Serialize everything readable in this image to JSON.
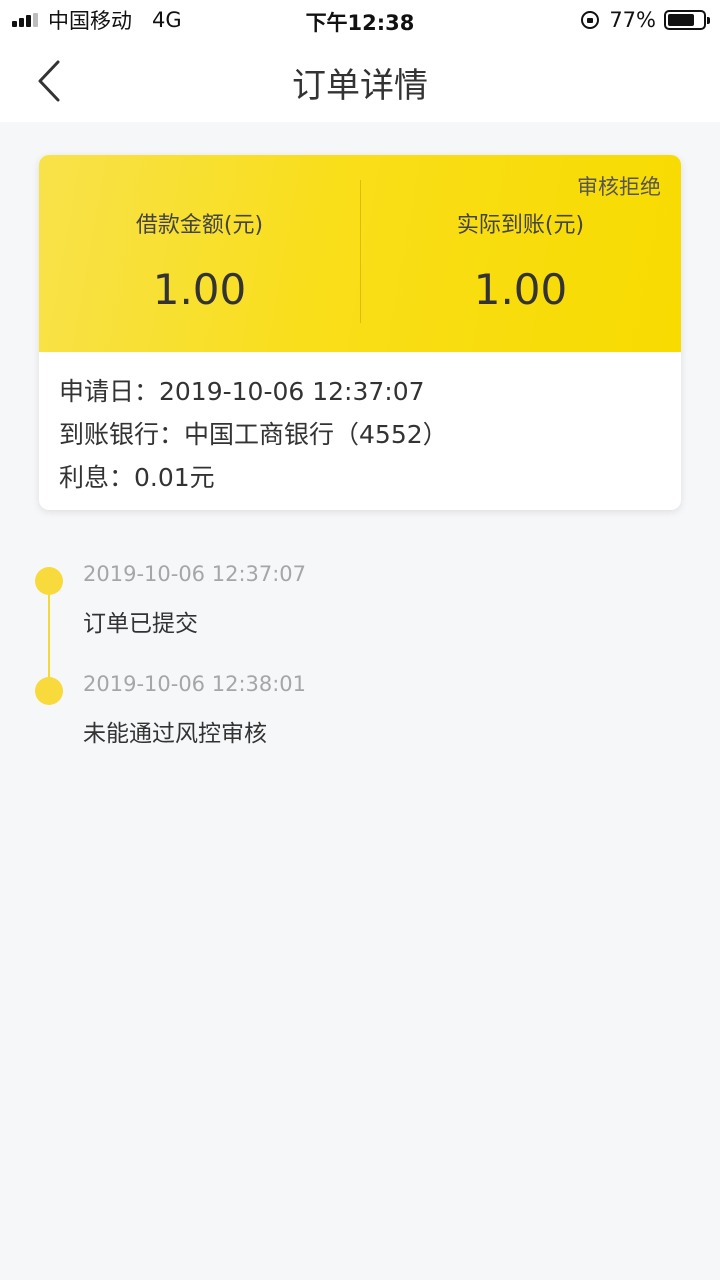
{
  "status_bar": {
    "carrier": "中国移动",
    "network": "4G",
    "time": "下午12:38",
    "battery": "77%",
    "battery_level": 0.77
  },
  "nav": {
    "title": "订单详情",
    "back_icon": "chevron-left-icon"
  },
  "order": {
    "status": "审核拒绝",
    "loan_amount_label": "借款金额(元)",
    "loan_amount": "1.00",
    "received_amount_label": "实际到账(元)",
    "received_amount": "1.00",
    "apply_date_line": "申请日：2019-10-06 12:37:07",
    "bank_line": "到账银行：中国工商银行（4552）",
    "interest_line": "利息：0.01元"
  },
  "timeline": [
    {
      "time": "2019-10-06 12:37:07",
      "desc": "订单已提交"
    },
    {
      "time": "2019-10-06 12:38:01",
      "desc": "未能通过风控审核"
    }
  ],
  "colors": {
    "accent_yellow": "#f8db00",
    "timeline_dot": "#f8da3c",
    "background": "#f6f7f9"
  }
}
